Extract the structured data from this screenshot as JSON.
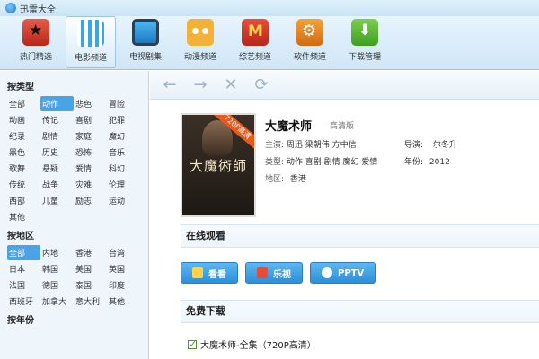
{
  "app": {
    "title": "迅雷大全"
  },
  "toolbar": {
    "items": [
      {
        "label": "热门精选",
        "icon": "hot-icon"
      },
      {
        "label": "电影频道",
        "icon": "movie-icon",
        "active": true
      },
      {
        "label": "电视剧集",
        "icon": "tv-icon"
      },
      {
        "label": "动漫频道",
        "icon": "anime-icon"
      },
      {
        "label": "综艺频道",
        "icon": "variety-icon"
      },
      {
        "label": "软件频道",
        "icon": "software-icon"
      },
      {
        "label": "下载管理",
        "icon": "download-icon"
      }
    ]
  },
  "sidebar": {
    "genre_title": "按类型",
    "genres": [
      "全部",
      "动作",
      "悲色",
      "冒险",
      "动画",
      "传记",
      "喜剧",
      "犯罪",
      "纪录",
      "剧情",
      "家庭",
      "魔幻",
      "黑色",
      "历史",
      "恐怖",
      "音乐",
      "歌舞",
      "悬疑",
      "爱情",
      "科幻",
      "传统",
      "战争",
      "灾难",
      "伦理",
      "西部",
      "儿童",
      "励志",
      "运动",
      "其他"
    ],
    "genre_selected": "动作",
    "region_title": "按地区",
    "regions": [
      "全部",
      "内地",
      "香港",
      "台湾",
      "日本",
      "韩国",
      "美国",
      "英国",
      "法国",
      "德国",
      "泰国",
      "印度",
      "西班牙",
      "加拿大",
      "意大利",
      "其他"
    ],
    "region_selected": "全部",
    "year_title": "按年份"
  },
  "nav": {
    "back": "←",
    "forward": "→",
    "stop": "✕",
    "refresh": "⟳"
  },
  "movie": {
    "title": "大魔术师",
    "quality": "高清版",
    "poster_title": "大魔術師",
    "badge": "720P高清",
    "starring_label": "主演:",
    "starring": "周迅  梁朝伟  方中信",
    "director_label": "导演:",
    "director": "尔冬升",
    "genre_label": "类型:",
    "genres": "动作  喜剧  剧情  魔幻  爱情",
    "year_label": "年份:",
    "year": "2012",
    "region_label": "地区:",
    "region": "香港"
  },
  "online": {
    "title": "在线观看",
    "sources": [
      "看看",
      "乐视",
      "PPTV"
    ]
  },
  "download": {
    "title": "免费下载",
    "item": "大魔术师-全集（720P高清）"
  },
  "colors": {
    "accent": "#4aa3e6",
    "sidebar_bg": "#eef6fc",
    "button_blue": "#2d8fd8"
  }
}
